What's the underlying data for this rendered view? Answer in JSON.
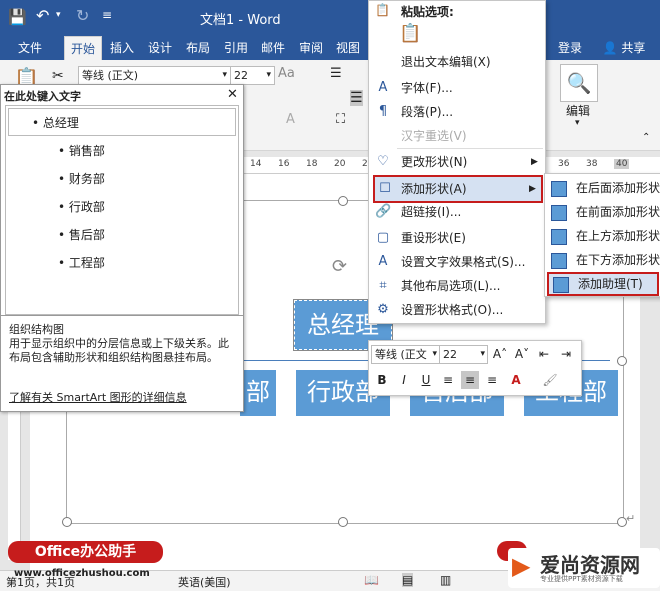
{
  "titlebar": {
    "doc_title": "文档1 - Word",
    "undo_icon": "undo-icon",
    "redo_icon": "redo-icon",
    "save_icon": "save-icon"
  },
  "tabs": [
    "文件",
    "开始",
    "插入",
    "设计",
    "布局",
    "引用",
    "邮件",
    "审阅",
    "视图"
  ],
  "active_tab": "开始",
  "account": {
    "login": "登录",
    "share": "共享"
  },
  "ribbon": {
    "font_name": "等线 (正文)",
    "font_size": "22",
    "edit_label": "编辑"
  },
  "ruler_ticks": [
    "14",
    "16",
    "18",
    "20",
    "22",
    "36",
    "38",
    "40"
  ],
  "text_pane": {
    "title": "在此处键入文字",
    "items": [
      {
        "level": 1,
        "text": "总经理"
      },
      {
        "level": 2,
        "text": "销售部"
      },
      {
        "level": 2,
        "text": "财务部"
      },
      {
        "level": 2,
        "text": "行政部"
      },
      {
        "level": 2,
        "text": "售后部"
      },
      {
        "level": 2,
        "text": "工程部"
      }
    ],
    "info_title": "组织结构图",
    "info_desc": "用于显示组织中的分层信息或上下级关系。此布局包含辅助形状和组织结构图悬挂布局。",
    "info_link": "了解有关 SmartArt 图形的详细信息"
  },
  "smartart": {
    "top_node": "总经理",
    "nodes": [
      "部",
      "行政部",
      "售后部",
      "工程部"
    ]
  },
  "context_menu": {
    "paste_options": "粘贴选项:",
    "items": [
      {
        "label": "退出文本编辑(X)",
        "icon": ""
      },
      {
        "label": "字体(F)...",
        "icon": "font-icon"
      },
      {
        "label": "段落(P)...",
        "icon": "paragraph-icon"
      },
      {
        "label": "汉字重选(V)",
        "icon": ""
      },
      {
        "label": "更改形状(N)",
        "icon": "change-shape-icon"
      },
      {
        "label": "添加形状(A)",
        "icon": "add-shape-icon"
      },
      {
        "label": "超链接(I)...",
        "icon": "hyperlink-icon"
      },
      {
        "label": "重设形状(E)",
        "icon": "reset-shape-icon"
      },
      {
        "label": "设置文字效果格式(S)...",
        "icon": "text-effect-icon"
      },
      {
        "label": "其他布局选项(L)...",
        "icon": "layout-options-icon"
      },
      {
        "label": "设置形状格式(O)...",
        "icon": "format-shape-icon"
      }
    ]
  },
  "submenu": {
    "items": [
      "在后面添加形状",
      "在前面添加形状",
      "在上方添加形状",
      "在下方添加形状",
      "添加助理(T)"
    ]
  },
  "mini_toolbar": {
    "font_name": "等线 (正文",
    "font_size": "22"
  },
  "statusbar": {
    "language": "英语(美国)",
    "page_info": "第1页，共1页"
  },
  "watermarks": {
    "left": "Office办公助手",
    "left_url": "www.officezhushou.com",
    "right": "爱尚资源网",
    "right_sub": "专业提供PPT素材资源下载"
  },
  "colors": {
    "word_blue": "#2b579a",
    "smartart_blue": "#5b9bd5",
    "highlight_red": "#c61c1c"
  }
}
